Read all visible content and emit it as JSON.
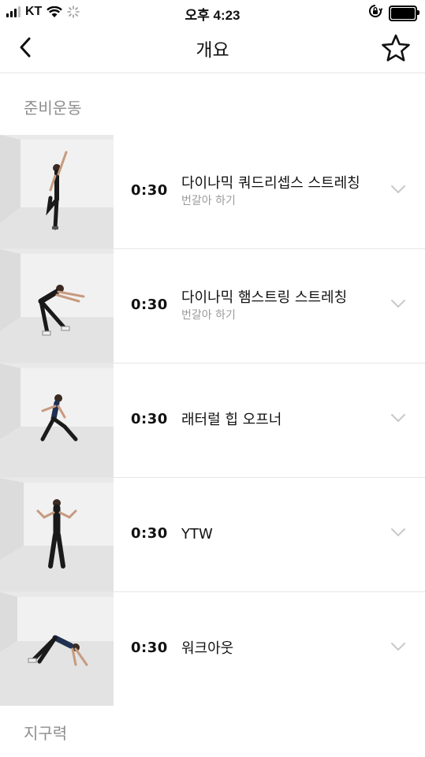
{
  "status_bar": {
    "carrier": "KT",
    "time": "오후 4:23"
  },
  "nav": {
    "title": "개요",
    "back_icon": "chevron-left-icon",
    "favorite_icon": "star-outline-icon"
  },
  "sections": {
    "warmup_title": "준비운동",
    "endurance_title": "지구력"
  },
  "exercises": [
    {
      "duration": "0:30",
      "name": "다이나믹 쿼드리셉스 스트레칭",
      "sub": "번갈아 하기"
    },
    {
      "duration": "0:30",
      "name": "다이나믹 햄스트링 스트레칭",
      "sub": "번갈아 하기"
    },
    {
      "duration": "0:30",
      "name": "래터럴 힙 오프너",
      "sub": ""
    },
    {
      "duration": "0:30",
      "name": "YTW",
      "sub": ""
    },
    {
      "duration": "0:30",
      "name": "워크아웃",
      "sub": ""
    }
  ],
  "colors": {
    "divider": "#e6e6e6",
    "secondary_text": "#9a9a9a",
    "section_header": "#8e8e8e"
  }
}
